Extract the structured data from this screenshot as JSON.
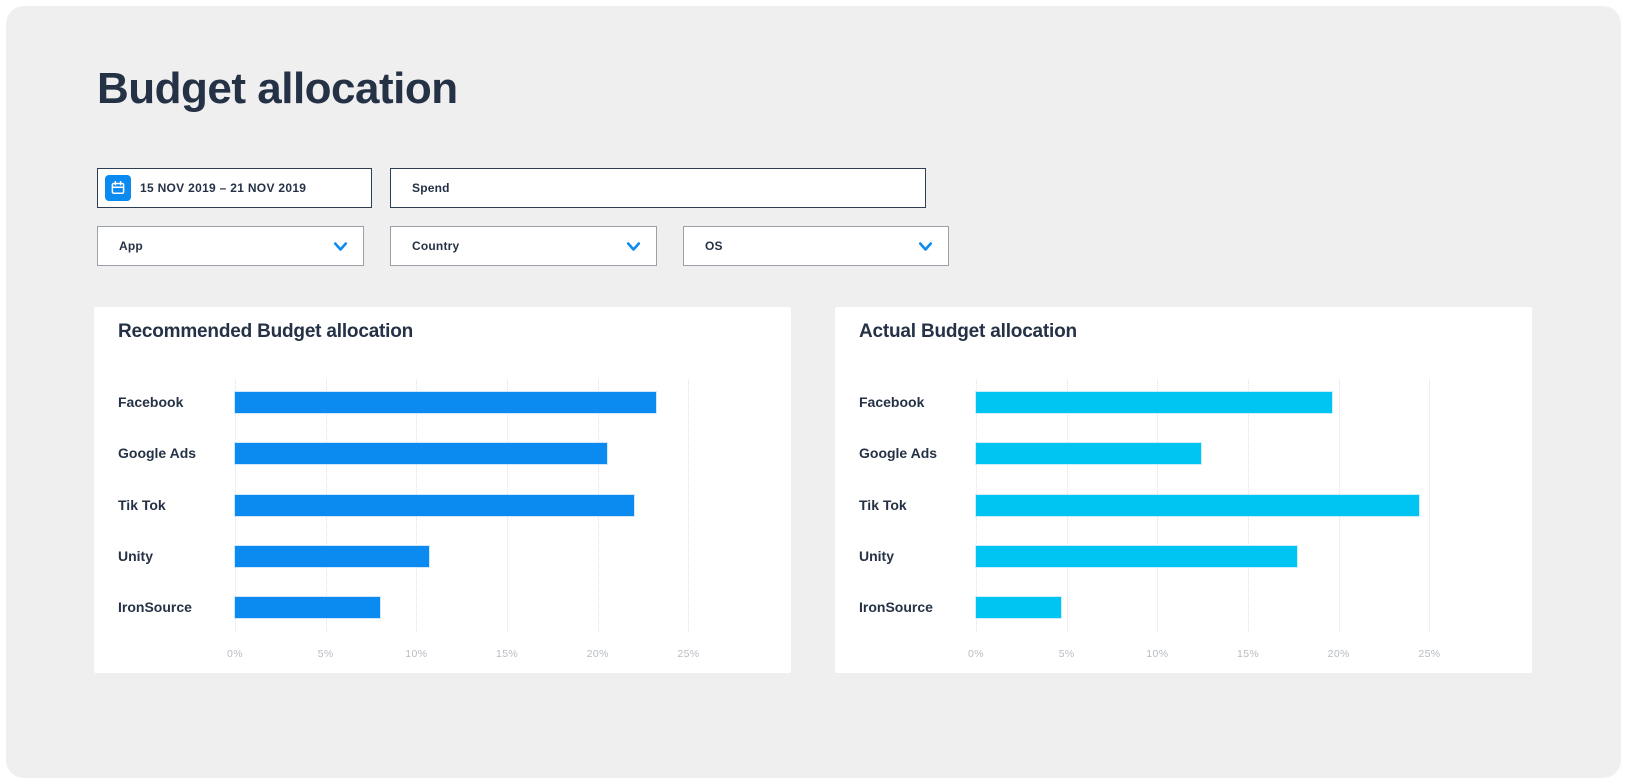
{
  "page": {
    "title": "Budget allocation"
  },
  "filters": {
    "date_range": {
      "value": "15 NOV 2019 – 21 NOV 2019",
      "icon": "calendar-icon"
    },
    "spend": {
      "label": "Spend"
    },
    "app": {
      "label": "App"
    },
    "country": {
      "label": "Country"
    },
    "os": {
      "label": "OS"
    }
  },
  "colors": {
    "background": "#efeff0",
    "card": "#ffffff",
    "navy_text": "#253246",
    "primary_blue": "#0b8af0",
    "cyan": "#00c4f2",
    "dark_border": "#2d3e53",
    "gray_border": "#9aa1a9",
    "gridline": "#dfe1e6",
    "tick_label": "#b8bcc2"
  },
  "chart_data": [
    {
      "type": "bar",
      "orientation": "horizontal",
      "title": "Recommended Budget allocation",
      "categories": [
        "Facebook",
        "Google Ads",
        "Tik Tok",
        "Unity",
        "IronSource"
      ],
      "values": [
        23.2,
        20.5,
        22.0,
        10.7,
        8.0
      ],
      "unit": "%",
      "xlabel": "",
      "ylabel": "",
      "xlim": [
        0,
        29
      ],
      "xticks": [
        0,
        5,
        10,
        15,
        20,
        25
      ],
      "xtick_labels": [
        "0%",
        "5%",
        "10%",
        "15%",
        "20%",
        "25%"
      ],
      "bar_color": "#0b8af0",
      "grid": "dotted-vertical",
      "legend": "none"
    },
    {
      "type": "bar",
      "orientation": "horizontal",
      "title": "Actual Budget allocation",
      "categories": [
        "Facebook",
        "Google Ads",
        "Tik Tok",
        "Unity",
        "IronSource"
      ],
      "values": [
        19.6,
        12.4,
        24.4,
        17.7,
        4.7
      ],
      "unit": "%",
      "xlabel": "",
      "ylabel": "",
      "xlim": [
        0,
        29
      ],
      "xticks": [
        0,
        5,
        10,
        15,
        20,
        25
      ],
      "xtick_labels": [
        "0%",
        "5%",
        "10%",
        "15%",
        "20%",
        "25%"
      ],
      "bar_color": "#00c4f2",
      "grid": "dotted-vertical",
      "legend": "none"
    }
  ]
}
